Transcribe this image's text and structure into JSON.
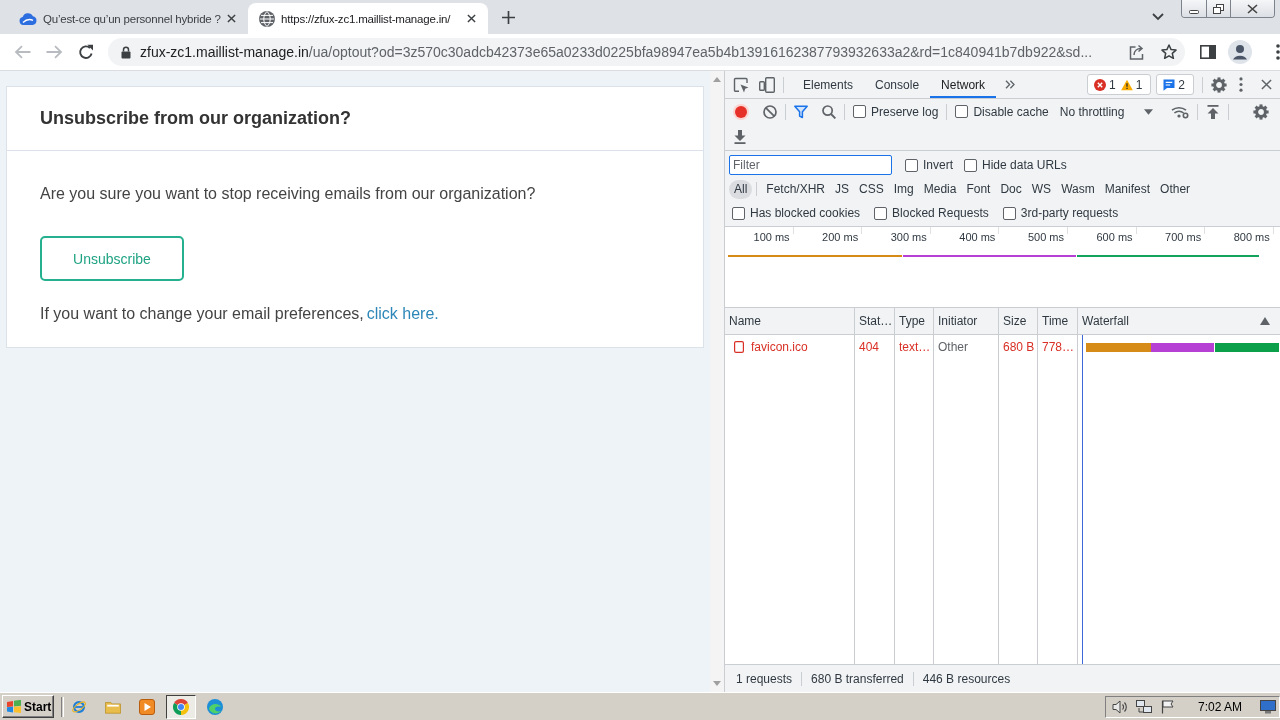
{
  "browser": {
    "tabs": [
      {
        "title": "Qu’est-ce qu’un personnel hybride ?",
        "selected": false
      },
      {
        "title": "https://zfux-zc1.maillist-manage.in/",
        "selected": true
      }
    ],
    "navigation": {
      "back_disabled": true,
      "forward_disabled": true
    },
    "address": {
      "host": "zfux-zc1.maillist-manage.in",
      "path": "/ua/optout?od=3z570c30adcb42373e65a0233d0225bfa98947ea5b4b13916162387793932633a2&rd=1c840941b7db922&sd..."
    }
  },
  "page": {
    "title": "Unsubscribe from our organization?",
    "question": "Are you sure you want to stop receiving emails from our organization?",
    "button": "Unsubscribe",
    "preferences_text": "If you want to change your email preferences,",
    "preferences_link": "click here."
  },
  "devtools": {
    "tabs": [
      {
        "label": "Elements",
        "selected": false
      },
      {
        "label": "Console",
        "selected": false
      },
      {
        "label": "Network",
        "selected": true
      }
    ],
    "issues": {
      "errors": "1",
      "warnings": "1",
      "messages": "2"
    },
    "toolbar": {
      "recording": true,
      "preserve_log": {
        "label": "Preserve log",
        "checked": false
      },
      "disable_cache": {
        "label": "Disable cache",
        "checked": false
      },
      "throttling": "No throttling"
    },
    "filter": {
      "placeholder": "Filter",
      "focused": true,
      "options": [
        {
          "label": "Invert",
          "checked": false
        },
        {
          "label": "Hide data URLs",
          "checked": false
        }
      ]
    },
    "types": [
      {
        "label": "All",
        "selected": true
      },
      {
        "label": "Fetch/XHR",
        "selected": false
      },
      {
        "label": "JS",
        "selected": false
      },
      {
        "label": "CSS",
        "selected": false
      },
      {
        "label": "Img",
        "selected": false
      },
      {
        "label": "Media",
        "selected": false
      },
      {
        "label": "Font",
        "selected": false
      },
      {
        "label": "Doc",
        "selected": false
      },
      {
        "label": "WS",
        "selected": false
      },
      {
        "label": "Wasm",
        "selected": false
      },
      {
        "label": "Manifest",
        "selected": false
      },
      {
        "label": "Other",
        "selected": false
      }
    ],
    "request_filters": [
      {
        "label": "Has blocked cookies",
        "checked": false
      },
      {
        "label": "Blocked Requests",
        "checked": false
      },
      {
        "label": "3rd-party requests",
        "checked": false
      }
    ],
    "overview": {
      "ticks": [
        "100 ms",
        "200 ms",
        "300 ms",
        "400 ms",
        "500 ms",
        "600 ms",
        "700 ms",
        "800 ms"
      ]
    },
    "table": {
      "columns": [
        "Name",
        "Stat…",
        "Type",
        "Initiator",
        "Size",
        "Time",
        "Waterfall"
      ],
      "rows": [
        {
          "cells": [
            "favicon.ico",
            "404",
            "text…",
            "Other",
            "680 B",
            "778…"
          ],
          "failed": true
        }
      ]
    },
    "summary": [
      "1 requests",
      "680 B transferred",
      "446 B resources"
    ]
  },
  "taskbar": {
    "start": "Start",
    "apps": [
      {
        "selected": false
      },
      {
        "selected": false
      },
      {
        "selected": false
      },
      {
        "selected": true
      },
      {
        "selected": false
      }
    ],
    "clock": "7:02 AM"
  }
}
